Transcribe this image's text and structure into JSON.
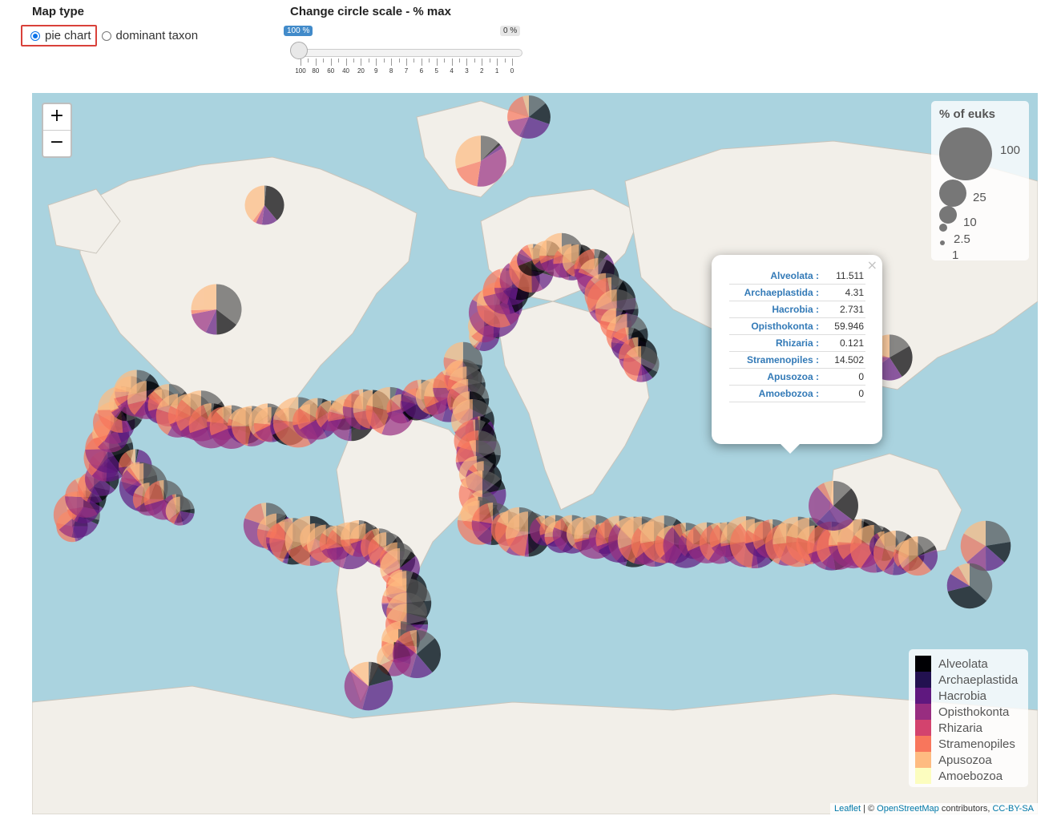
{
  "controls": {
    "map_type_label": "Map type",
    "radio_pie": "pie chart",
    "radio_dominant": "dominant taxon",
    "scale_label": "Change circle scale - % max",
    "slider_value_tag": "100 %",
    "slider_max_tag": "0 %",
    "slider_ticks": [
      "100",
      "80",
      "60",
      "40",
      "20",
      "9",
      "8",
      "7",
      "6",
      "5",
      "4",
      "3",
      "2",
      "1",
      "0"
    ]
  },
  "map": {
    "zoom_in": "+",
    "zoom_out": "−",
    "size_legend": {
      "title": "% of euks",
      "labels": [
        "100",
        "25",
        "10",
        "2.5",
        "1"
      ]
    },
    "popup": {
      "close": "×",
      "rows": [
        {
          "key": "Alveolata :",
          "value": "11.511"
        },
        {
          "key": "Archaeplastida :",
          "value": "4.31"
        },
        {
          "key": "Hacrobia :",
          "value": "2.731"
        },
        {
          "key": "Opisthokonta :",
          "value": "59.946"
        },
        {
          "key": "Rhizaria :",
          "value": "0.121"
        },
        {
          "key": "Stramenopiles :",
          "value": "14.502"
        },
        {
          "key": "Apusozoa :",
          "value": "0"
        },
        {
          "key": "Amoebozoa :",
          "value": "0"
        }
      ]
    },
    "color_legend": [
      {
        "label": "Alveolata",
        "color": "#000004"
      },
      {
        "label": "Archaeplastida",
        "color": "#221150"
      },
      {
        "label": "Hacrobia",
        "color": "#5f187f"
      },
      {
        "label": "Opisthokonta",
        "color": "#982d80"
      },
      {
        "label": "Rhizaria",
        "color": "#d3436e"
      },
      {
        "label": "Stramenopiles",
        "color": "#f8765c"
      },
      {
        "label": "Apusozoa",
        "color": "#febb81"
      },
      {
        "label": "Amoebozoa",
        "color": "#fcfdbf"
      }
    ],
    "attribution": {
      "leaflet": "Leaflet",
      "sep": " | © ",
      "osm": "OpenStreetMap",
      "contrib": " contributors, ",
      "license": "CC-BY-SA"
    }
  }
}
